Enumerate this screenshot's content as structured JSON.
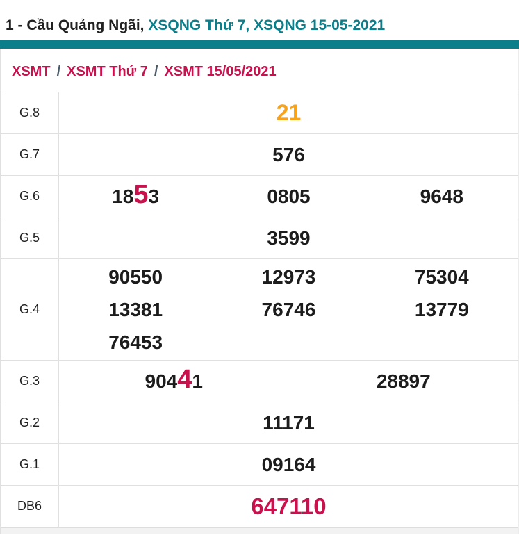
{
  "title": {
    "prefix": "1 - Cầu Quảng Ngãi, ",
    "weekday_link": "XSQNG Thứ 7, ",
    "date_link": "XSQNG 15-05-2021"
  },
  "breadcrumb": {
    "separator": "/",
    "items": [
      "XSMT",
      "XSMT Thứ 7",
      "XSMT 15/05/2021"
    ]
  },
  "table": {
    "rows": [
      {
        "label": "G.8",
        "cols": 1,
        "variant": "prize-g8",
        "values": [
          "21"
        ]
      },
      {
        "label": "G.7",
        "cols": 1,
        "variant": "",
        "values": [
          "576"
        ]
      },
      {
        "label": "G.6",
        "cols": 3,
        "variant": "",
        "values": [
          {
            "pre": "18",
            "hl": "5",
            "post": "3"
          },
          "0805",
          "9648"
        ]
      },
      {
        "label": "G.5",
        "cols": 1,
        "variant": "",
        "values": [
          "3599"
        ]
      },
      {
        "label": "G.4",
        "cols": 3,
        "variant": "",
        "values": [
          "90550",
          "12973",
          "75304",
          "13381",
          "76746",
          "13779",
          "76453"
        ]
      },
      {
        "label": "G.3",
        "cols": 2,
        "variant": "",
        "values": [
          {
            "pre": "904",
            "hl": "4",
            "post": "1"
          },
          "28897"
        ]
      },
      {
        "label": "G.2",
        "cols": 1,
        "variant": "",
        "values": [
          "11171"
        ]
      },
      {
        "label": "G.1",
        "cols": 1,
        "variant": "",
        "values": [
          "09164"
        ]
      },
      {
        "label": "DB6",
        "cols": 1,
        "variant": "prize-db",
        "values": [
          "647110"
        ]
      }
    ]
  },
  "colors": {
    "teal": "#0a7e8a",
    "crimson": "#c9114e",
    "orange": "#f8a31a",
    "number_text": "#1c1c1c",
    "border": "#e0e0e0"
  }
}
